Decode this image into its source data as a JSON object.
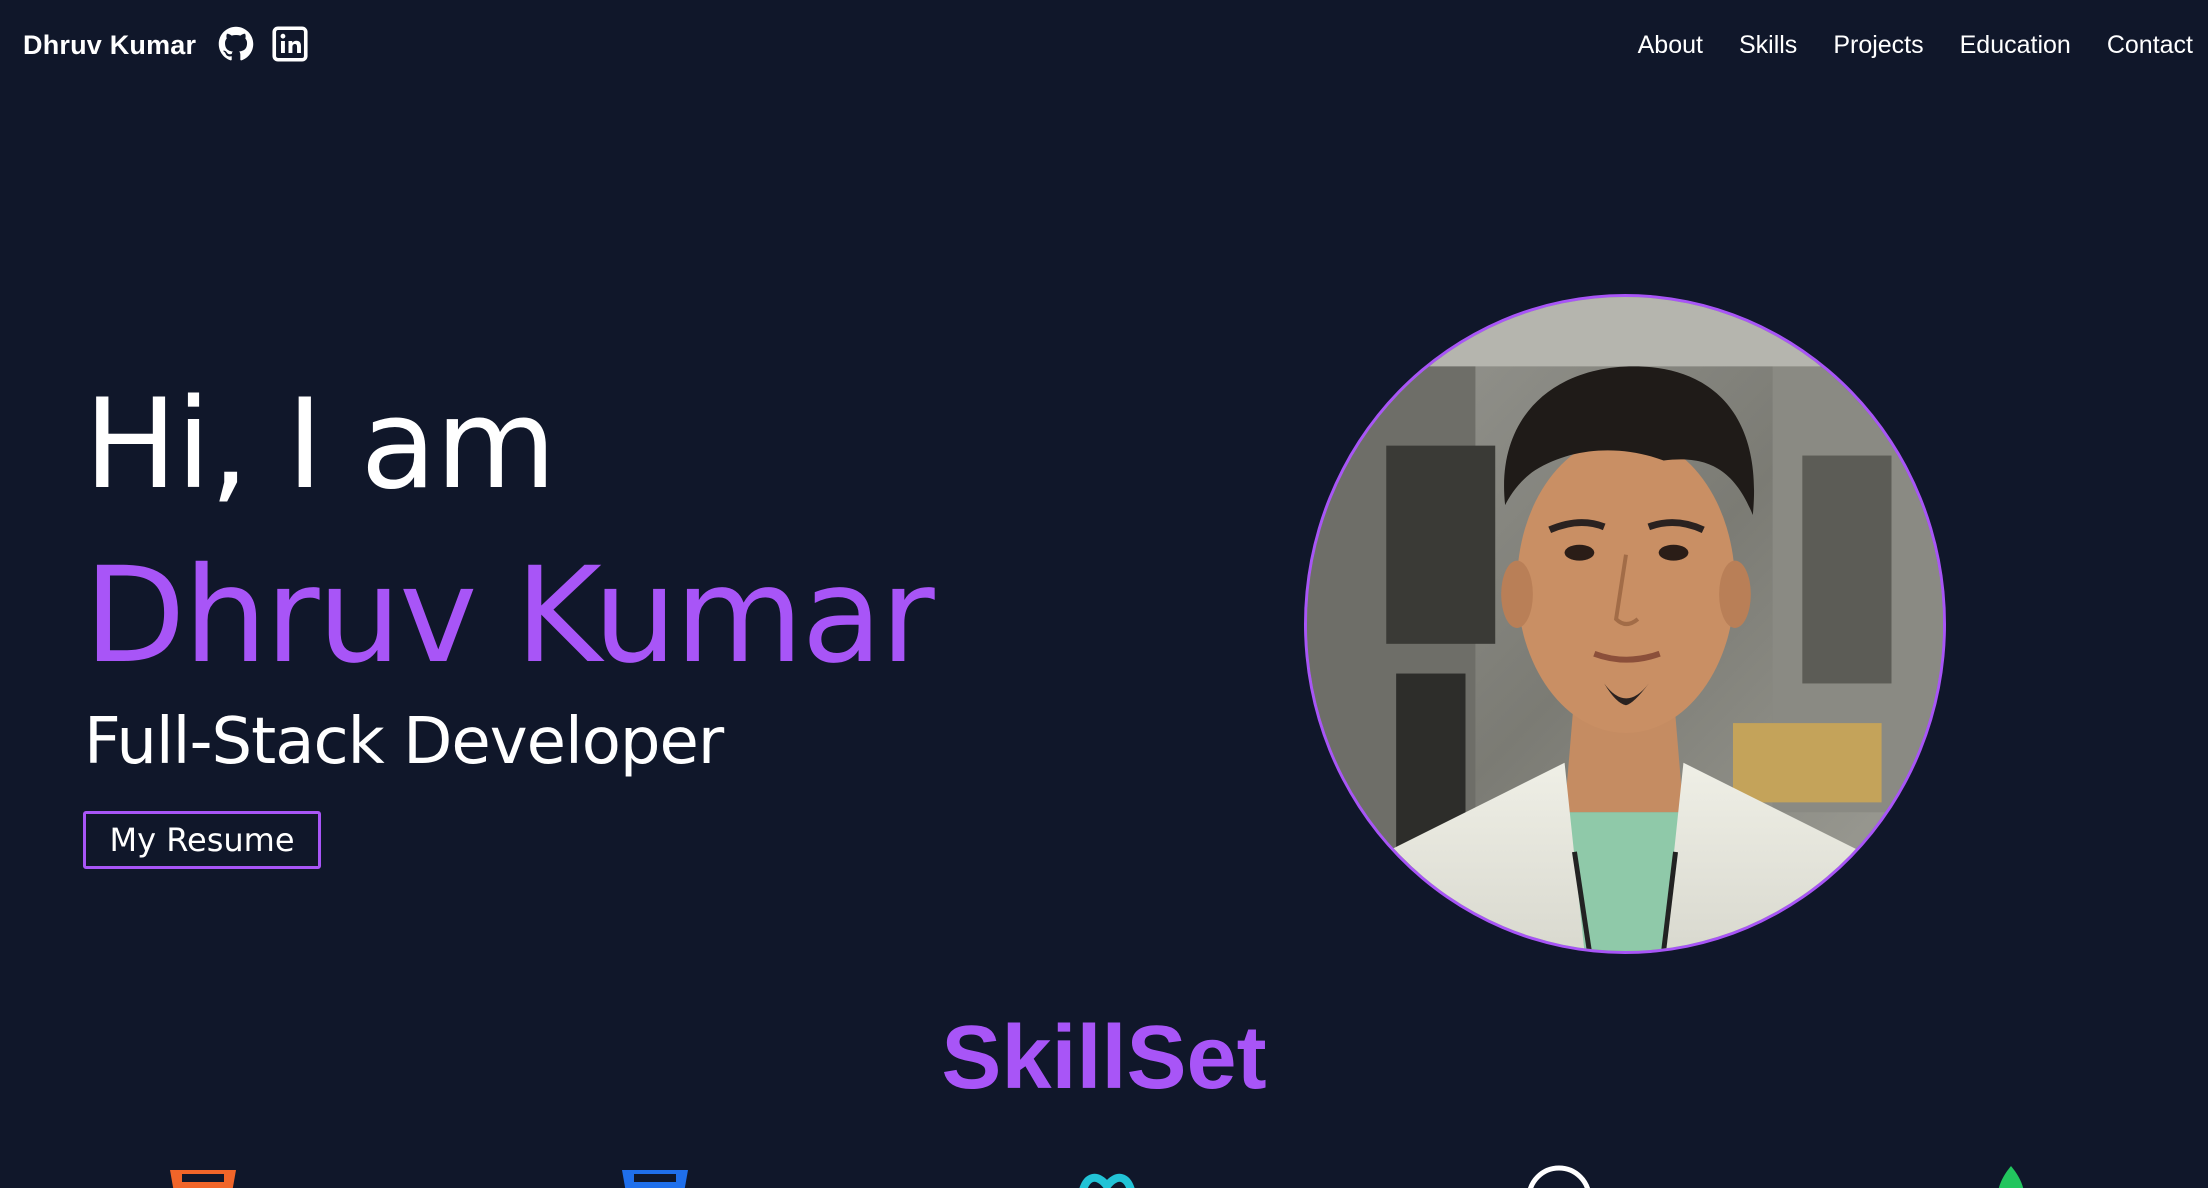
{
  "nav": {
    "brand": "Dhruv Kumar",
    "icons": [
      "github-icon",
      "linkedin-icon"
    ],
    "links": [
      "About",
      "Skills",
      "Projects",
      "Education",
      "Contact"
    ]
  },
  "hero": {
    "greeting": "Hi, I am",
    "name": "Dhruv Kumar",
    "role": "Full-Stack Developer",
    "resume_button": "My Resume",
    "photo": "profile-photo"
  },
  "skills": {
    "title": "SkillSet",
    "icons": [
      "html5-icon",
      "css3-icon",
      "tailwind-icon",
      "github-icon",
      "mongodb-icon"
    ]
  },
  "colors": {
    "background": "#10172a",
    "accent": "#a855f7",
    "text": "#ffffff"
  }
}
